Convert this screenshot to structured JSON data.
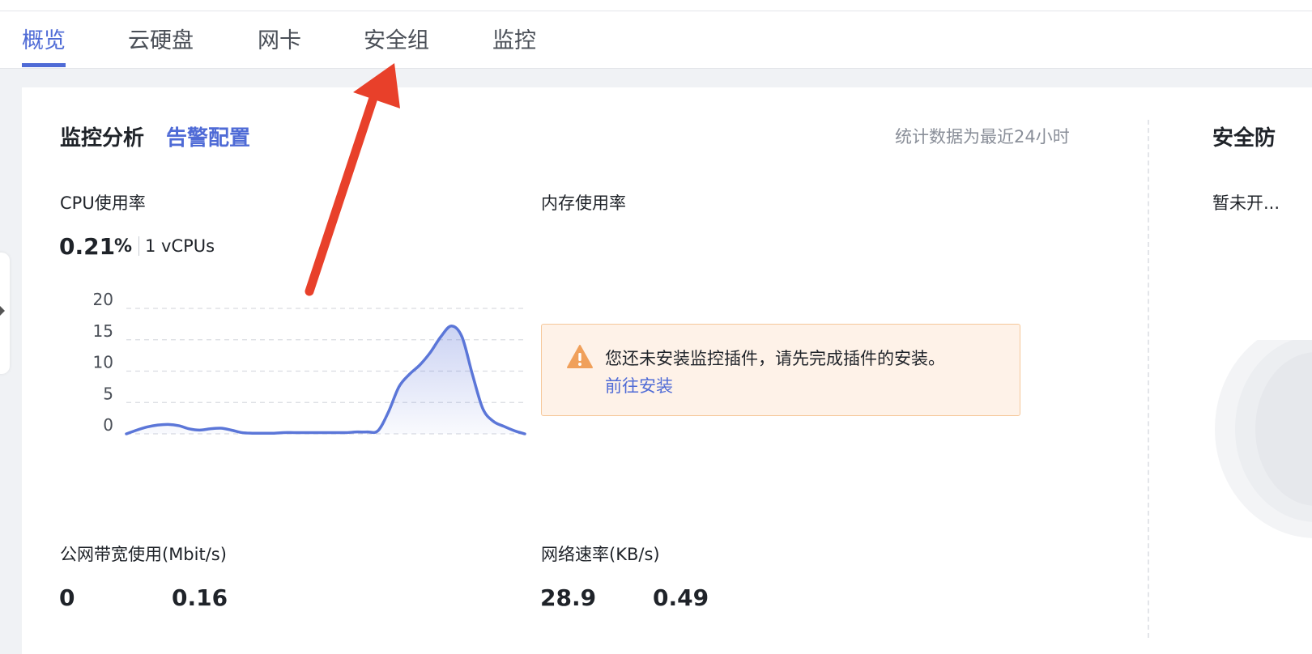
{
  "tabs": [
    {
      "label": "概览",
      "active": true
    },
    {
      "label": "云硬盘",
      "active": false
    },
    {
      "label": "网卡",
      "active": false
    },
    {
      "label": "安全组",
      "active": false
    },
    {
      "label": "监控",
      "active": false
    }
  ],
  "monitor": {
    "title": "监控分析",
    "alarm_link": "告警配置",
    "stat_note": "统计数据为最近24小时"
  },
  "cpu": {
    "label": "CPU使用率",
    "value": "0.21",
    "unit": "%",
    "vcpus": "1 vCPUs"
  },
  "memory": {
    "label": "内存使用率",
    "notice_text": "您还未安装监控插件，请先完成插件的安装。",
    "notice_link": "前往安装"
  },
  "bandwidth": {
    "label": "公网带宽使用(Mbit/s)",
    "value1": "0",
    "value2": "0.16"
  },
  "network": {
    "label": "网络速率(KB/s)",
    "value1": "28.9",
    "value2": "0.49"
  },
  "right_panel": {
    "title": "安全防",
    "subtitle": "暂未开..."
  },
  "colors": {
    "accent": "#4f6bd6",
    "warning": "#f0a05a",
    "annotation_arrow": "#e8402a"
  },
  "chart_data": {
    "type": "area",
    "title": "",
    "xlabel": "",
    "ylabel": "",
    "ylim": [
      0,
      20
    ],
    "yticks": [
      "20",
      "15",
      "10",
      "5",
      "0"
    ],
    "grid": true,
    "series": [
      {
        "values": [
          0.0,
          0.6,
          1.1,
          1.4,
          1.5,
          1.3,
          0.8,
          0.6,
          0.8,
          0.9,
          0.6,
          0.2,
          0.1,
          0.1,
          0.1,
          0.2,
          0.2,
          0.2,
          0.2,
          0.2,
          0.2,
          0.2,
          0.3,
          0.3,
          0.5,
          3.5,
          7.5,
          9.5,
          11.0,
          13.0,
          15.5,
          17.2,
          15.5,
          9.5,
          4.0,
          2.0,
          1.2,
          0.5,
          0.0
        ]
      }
    ]
  }
}
